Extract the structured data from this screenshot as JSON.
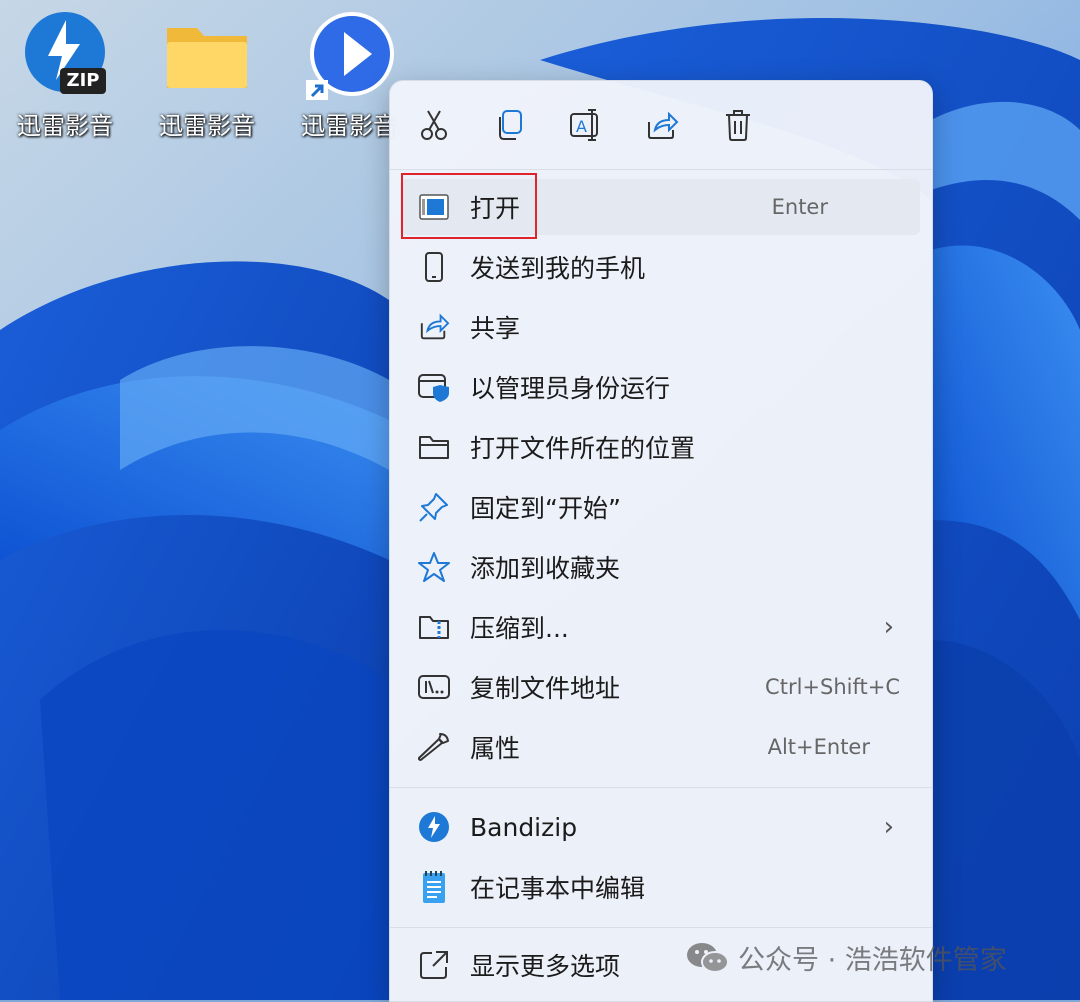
{
  "desktop": {
    "icons": [
      {
        "label": "迅雷影音",
        "icon": "bandizip-zip-icon",
        "badge": "ZIP"
      },
      {
        "label": "迅雷影音",
        "icon": "folder-icon"
      },
      {
        "label": "迅雷影音",
        "icon": "xunlei-player-shortcut-icon"
      }
    ]
  },
  "toolbar": [
    {
      "icon": "cut-icon"
    },
    {
      "icon": "copy-icon"
    },
    {
      "icon": "rename-icon"
    },
    {
      "icon": "share-icon"
    },
    {
      "icon": "delete-icon"
    }
  ],
  "menu_items": [
    {
      "label": "打开",
      "shortcut": "Enter",
      "icon": "open-app-icon",
      "highlighted": true
    },
    {
      "label": "发送到我的手机",
      "icon": "phone-icon"
    },
    {
      "label": "共享",
      "icon": "share-icon"
    },
    {
      "label": "以管理员身份运行",
      "icon": "admin-shield-icon"
    },
    {
      "label": "打开文件所在的位置",
      "icon": "folder-outline-icon"
    },
    {
      "label": "固定到“开始”",
      "icon": "pin-icon"
    },
    {
      "label": "添加到收藏夹",
      "icon": "star-icon"
    },
    {
      "label": "压缩到...",
      "icon": "zip-folder-icon",
      "submenu": "›"
    },
    {
      "label": "复制文件地址",
      "shortcut": "Ctrl+Shift+C",
      "icon": "copy-path-icon"
    },
    {
      "label": "属性",
      "shortcut": "Alt+Enter",
      "icon": "wrench-icon"
    },
    {
      "label": "Bandizip",
      "icon": "bandizip-icon",
      "submenu": "›"
    },
    {
      "label": "在记事本中编辑",
      "icon": "notepad-icon"
    },
    {
      "label": "显示更多选项",
      "icon": "show-more-icon"
    }
  ],
  "watermark": {
    "text": "公众号 · 浩浩软件管家",
    "icon": "wechat-icon"
  },
  "colors": {
    "accent": "#0a6cd6",
    "highlight_box": "#e0242c",
    "icon_blue": "#1e78d6"
  }
}
